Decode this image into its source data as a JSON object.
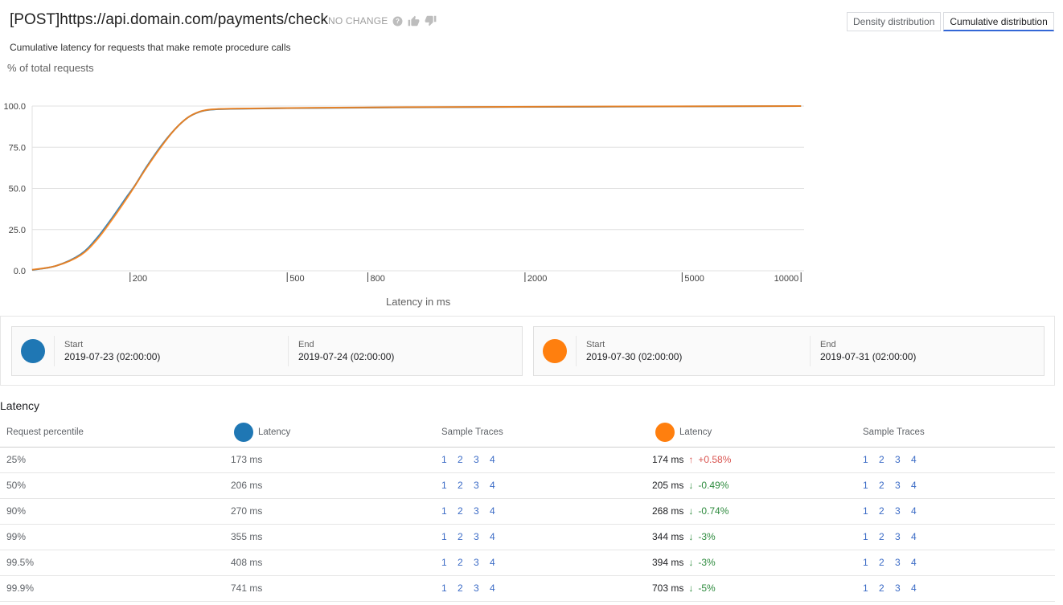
{
  "header": {
    "title": "[POST]https://api.domain.com/payments/check",
    "status_text": "NO CHANGE",
    "icons": [
      "help-icon",
      "thumbs-up-icon",
      "thumbs-down-icon"
    ],
    "subtitle": "Cumulative latency for requests that make remote procedure calls",
    "toggle": {
      "density_label": "Density distribution",
      "cumulative_label": "Cumulative distribution",
      "active": "cumulative"
    }
  },
  "chart_data": {
    "type": "line",
    "title": "",
    "ylabel": "% of total requests",
    "xlabel": "Latency in ms",
    "xscale": "log",
    "xlim": [
      113,
      10180
    ],
    "ylim": [
      0,
      100
    ],
    "yticks": [
      "0.0",
      "25.0",
      "50.0",
      "75.0",
      "100.0"
    ],
    "yticks_values": [
      0,
      25,
      50,
      75,
      100
    ],
    "xticks": [
      "200",
      "500",
      "800",
      "2000",
      "5000",
      "10000"
    ],
    "xticks_values": [
      200,
      500,
      800,
      2000,
      5000,
      10000
    ],
    "grid": true,
    "legend": "none",
    "series": [
      {
        "name": "2019-07-23 (02:00:00) – 2019-07-24 (02:00:00)",
        "color": "#1f77b4",
        "x": [
          113,
          130,
          150,
          165,
          180,
          195,
          206,
          220,
          240,
          260,
          280,
          300,
          320,
          360,
          500,
          1000,
          3000,
          10000
        ],
        "y": [
          0.5,
          3,
          10,
          20,
          32,
          44,
          52,
          63,
          76,
          86,
          93,
          96.5,
          97.8,
          98.3,
          98.7,
          99.2,
          99.6,
          100
        ]
      },
      {
        "name": "2019-07-30 (02:00:00) – 2019-07-31 (02:00:00)",
        "color": "#ff7f0e",
        "x": [
          113,
          130,
          150,
          165,
          180,
          195,
          205,
          220,
          240,
          260,
          280,
          300,
          320,
          360,
          500,
          1000,
          3000,
          10000
        ],
        "y": [
          0.6,
          3,
          9.5,
          19,
          31,
          43,
          51,
          62.5,
          75.5,
          86,
          93,
          96.6,
          97.9,
          98.4,
          98.8,
          99.3,
          99.7,
          100
        ]
      }
    ]
  },
  "ranges": [
    {
      "color": "#1f77b4",
      "start_label": "Start",
      "start": "2019-07-23 (02:00:00)",
      "end_label": "End",
      "end": "2019-07-24 (02:00:00)"
    },
    {
      "color": "#ff7f0e",
      "start_label": "Start",
      "start": "2019-07-30 (02:00:00)",
      "end_label": "End",
      "end": "2019-07-31 (02:00:00)"
    }
  ],
  "latency": {
    "title": "Latency",
    "headers": {
      "percentile": "Request percentile",
      "latency_a": "Latency",
      "traces_a": "Sample Traces",
      "latency_b": "Latency",
      "traces_b": "Sample Traces"
    },
    "rows": [
      {
        "percentile": "25%",
        "latency_a": "173 ms",
        "latency_b": "174 ms",
        "direction": "up",
        "arrow": "↑",
        "change": "+0.58%",
        "traces_a": [
          "1",
          "2",
          "3",
          "4"
        ],
        "traces_b": [
          "1",
          "2",
          "3",
          "4"
        ]
      },
      {
        "percentile": "50%",
        "latency_a": "206 ms",
        "latency_b": "205 ms",
        "direction": "down",
        "arrow": "↓",
        "change": "-0.49%",
        "traces_a": [
          "1",
          "2",
          "3",
          "4"
        ],
        "traces_b": [
          "1",
          "2",
          "3",
          "4"
        ]
      },
      {
        "percentile": "90%",
        "latency_a": "270 ms",
        "latency_b": "268 ms",
        "direction": "down",
        "arrow": "↓",
        "change": "-0.74%",
        "traces_a": [
          "1",
          "2",
          "3",
          "4"
        ],
        "traces_b": [
          "1",
          "2",
          "3",
          "4"
        ]
      },
      {
        "percentile": "99%",
        "latency_a": "355 ms",
        "latency_b": "344 ms",
        "direction": "down",
        "arrow": "↓",
        "change": "-3%",
        "traces_a": [
          "1",
          "2",
          "3",
          "4"
        ],
        "traces_b": [
          "1",
          "2",
          "3",
          "4"
        ]
      },
      {
        "percentile": "99.5%",
        "latency_a": "408 ms",
        "latency_b": "394 ms",
        "direction": "down",
        "arrow": "↓",
        "change": "-3%",
        "traces_a": [
          "1",
          "2",
          "3",
          "4"
        ],
        "traces_b": [
          "1",
          "2",
          "3",
          "4"
        ]
      },
      {
        "percentile": "99.9%",
        "latency_a": "741 ms",
        "latency_b": "703 ms",
        "direction": "down",
        "arrow": "↓",
        "change": "-5%",
        "traces_a": [
          "1",
          "2",
          "3",
          "4"
        ],
        "traces_b": [
          "1",
          "2",
          "3",
          "4"
        ]
      }
    ]
  }
}
